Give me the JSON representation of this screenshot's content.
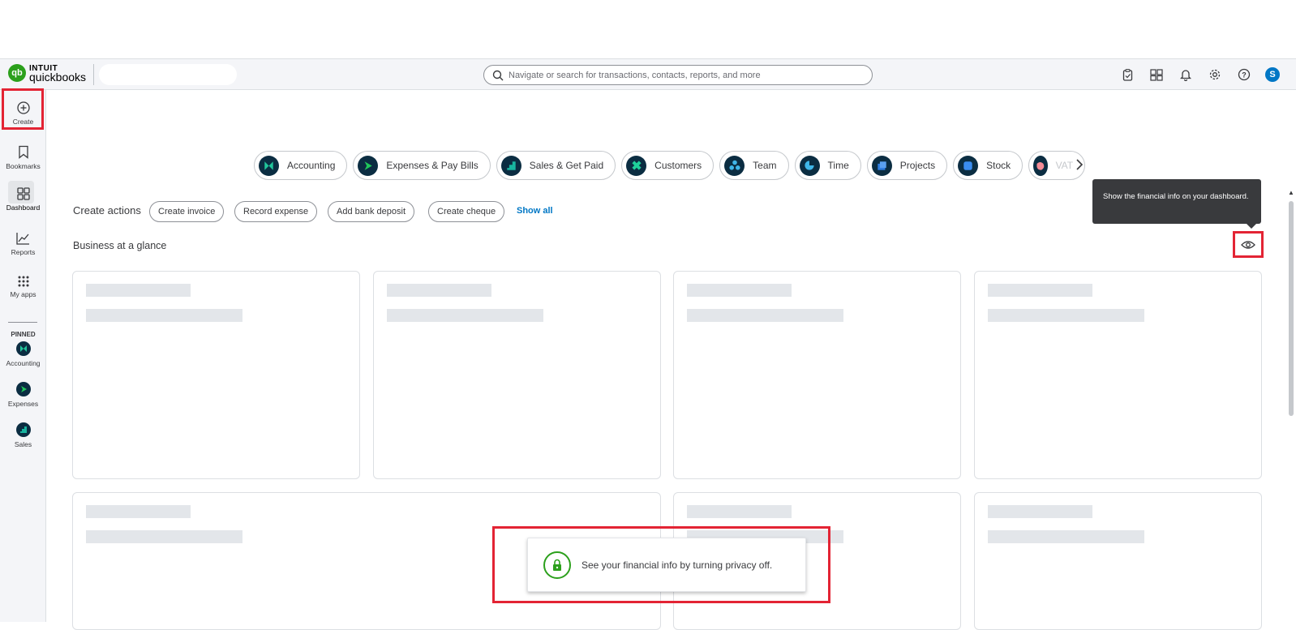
{
  "brand": {
    "top": "INTUIT",
    "name": "quickbooks",
    "mark": "qb"
  },
  "search": {
    "placeholder": "Navigate or search for transactions, contacts, reports, and more"
  },
  "top_icons": [
    "tasks-icon",
    "apps-icon",
    "bell-icon",
    "gear-icon",
    "help-icon"
  ],
  "user": {
    "initial": "S"
  },
  "sidebar": {
    "items": [
      {
        "label": "Create",
        "icon": "plus-circle-icon"
      },
      {
        "label": "Bookmarks",
        "icon": "bookmark-icon"
      },
      {
        "label": "Dashboard",
        "icon": "dashboard-icon"
      },
      {
        "label": "Reports",
        "icon": "chart-line-icon"
      },
      {
        "label": "My apps",
        "icon": "grid-icon"
      }
    ],
    "pinned_title": "PINNED",
    "pinned": [
      {
        "label": "Accounting"
      },
      {
        "label": "Expenses"
      },
      {
        "label": "Sales"
      }
    ]
  },
  "tabs": [
    {
      "label": "Accounting",
      "color": "#21c59b"
    },
    {
      "label": "Expenses & Pay Bills",
      "color": "#20c85a"
    },
    {
      "label": "Sales & Get Paid",
      "color": "#18b5a0"
    },
    {
      "label": "Customers",
      "color": "#1fd19a"
    },
    {
      "label": "Team",
      "color": "#3fb6e8"
    },
    {
      "label": "Time",
      "color": "#3fb6e8"
    },
    {
      "label": "Projects",
      "color": "#2d7de0"
    },
    {
      "label": "Stock",
      "color": "#3a8df0"
    },
    {
      "label": "VAT",
      "color": "#f48c97"
    }
  ],
  "create_actions": {
    "label": "Create actions",
    "buttons": [
      "Create invoice",
      "Record expense",
      "Add bank deposit",
      "Create cheque"
    ],
    "show_all": "Show all"
  },
  "glance": {
    "title": "Business at a glance"
  },
  "tooltip": {
    "text": "Show the financial info on your dashboard."
  },
  "privacy_toast": {
    "text": "See your financial info by turning privacy off."
  }
}
